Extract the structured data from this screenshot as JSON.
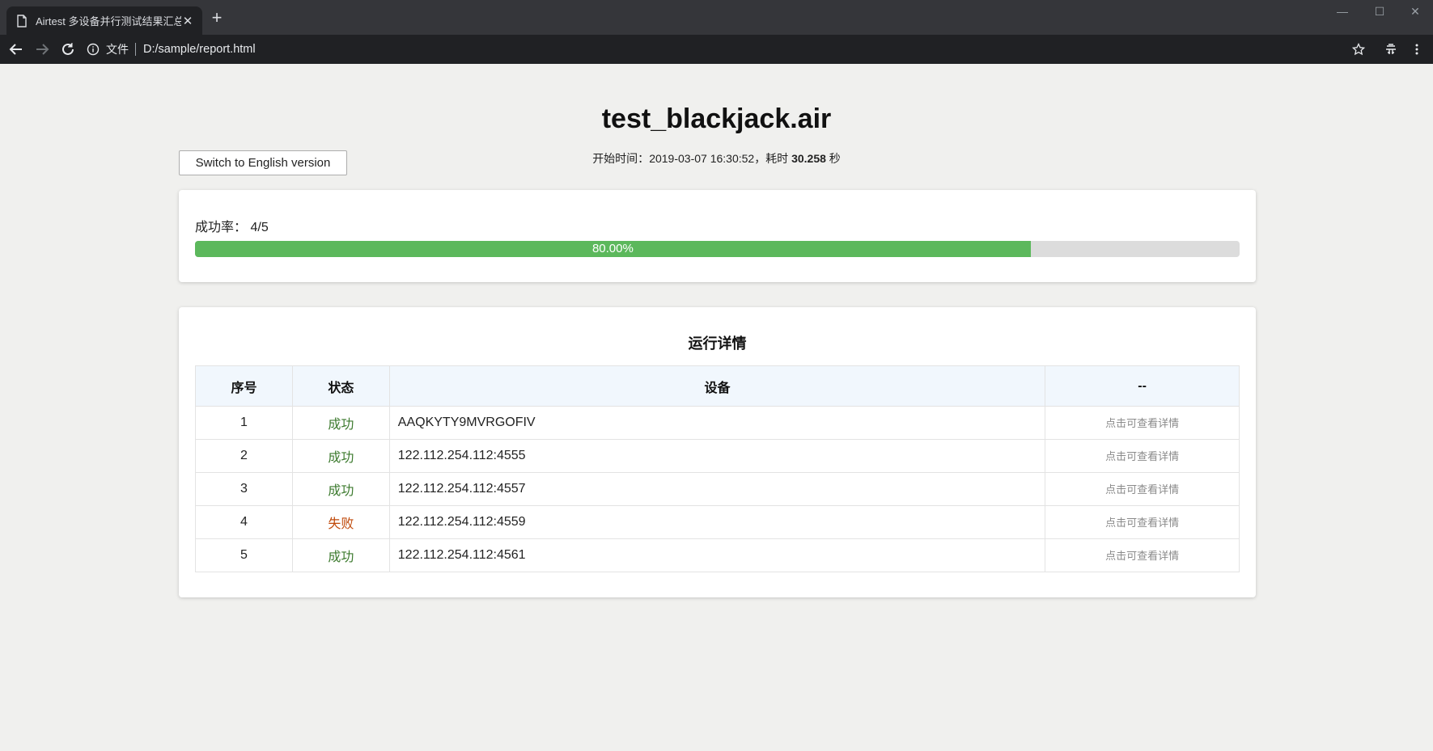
{
  "browser": {
    "tab_title": "Airtest 多设备并行测试结果汇总",
    "tab_close": "✕",
    "new_tab": "+",
    "scheme_label": "文件",
    "url": "D:/sample/report.html",
    "window_controls": {
      "minimize": "—",
      "maximize": "☐",
      "close": "✕"
    }
  },
  "header": {
    "title": "test_blackjack.air",
    "start_label": "开始时间：",
    "start_time": "2019-03-07 16:30:52",
    "elapsed_label": "，耗时",
    "elapsed_value": "30.258",
    "elapsed_unit": "秒",
    "lang_button": "Switch to English version"
  },
  "summary": {
    "rate_label": "成功率：",
    "rate_value": "4/5",
    "progress_percent": 80,
    "progress_text": "80.00%",
    "colors": {
      "fill": "#5cb85c",
      "track": "#dcdcdc"
    }
  },
  "details": {
    "title": "运行详情",
    "columns": [
      "序号",
      "状态",
      "设备",
      "--"
    ],
    "rows": [
      {
        "index": "1",
        "status": "成功",
        "status_type": "success",
        "device": "AAQKYTY9MVRGOFIV",
        "action": "点击可查看详情"
      },
      {
        "index": "2",
        "status": "成功",
        "status_type": "success",
        "device": "122.112.254.112:4555",
        "action": "点击可查看详情"
      },
      {
        "index": "3",
        "status": "成功",
        "status_type": "success",
        "device": "122.112.254.112:4557",
        "action": "点击可查看详情"
      },
      {
        "index": "4",
        "status": "失败",
        "status_type": "fail",
        "device": "122.112.254.112:4559",
        "action": "点击可查看详情"
      },
      {
        "index": "5",
        "status": "成功",
        "status_type": "success",
        "device": "122.112.254.112:4561",
        "action": "点击可查看详情"
      }
    ]
  }
}
